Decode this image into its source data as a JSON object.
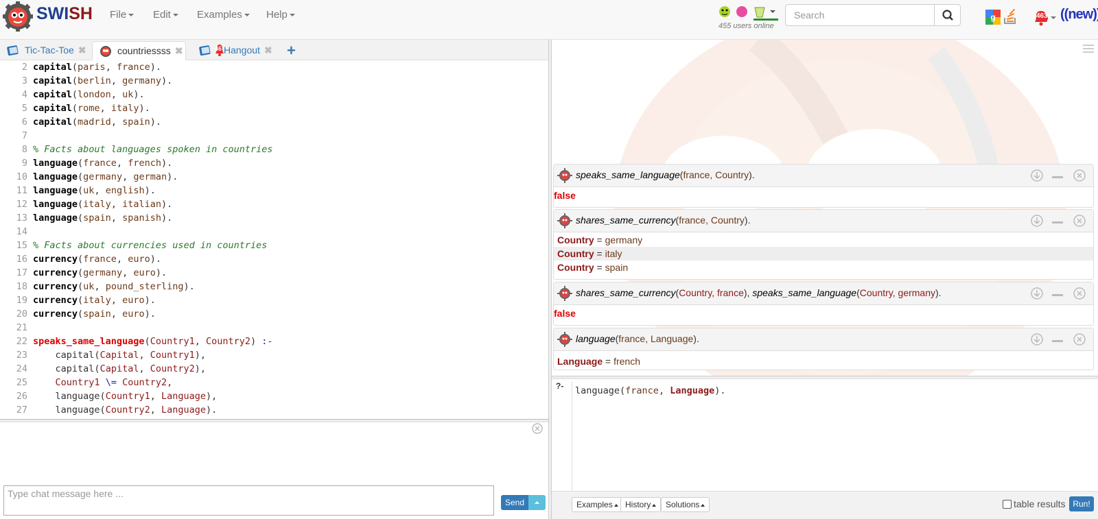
{
  "brand": {
    "part1": "SWI",
    "part2": "SH"
  },
  "menu": [
    {
      "label": "File"
    },
    {
      "label": "Edit"
    },
    {
      "label": "Examples"
    },
    {
      "label": "Help"
    }
  ],
  "users_online": "455 users online",
  "search": {
    "placeholder": "Search",
    "value": ""
  },
  "notification_count": "463",
  "new_badge": "((new))",
  "tabs": [
    {
      "label": "Tic-Tac-Toe"
    },
    {
      "label": "countriessss",
      "active": true
    },
    {
      "label": "Hangout",
      "badge": "46"
    }
  ],
  "editor": {
    "line_numbers": [
      "2",
      "3",
      "4",
      "5",
      "6",
      "7",
      "8",
      "9",
      "10",
      "11",
      "12",
      "13",
      "14",
      "15",
      "16",
      "17",
      "18",
      "19",
      "20",
      "21",
      "22",
      "23",
      "24",
      "25",
      "26",
      "27"
    ],
    "lines": [
      "capital(paris, france).",
      "capital(berlin, germany).",
      "capital(london, uk).",
      "capital(rome, italy).",
      "capital(madrid, spain).",
      "",
      "% Facts about languages spoken in countries",
      "language(france, french).",
      "language(germany, german).",
      "language(uk, english).",
      "language(italy, italian).",
      "language(spain, spanish).",
      "",
      "% Facts about currencies used in countries",
      "currency(france, euro).",
      "currency(germany, euro).",
      "currency(uk, pound_sterling).",
      "currency(italy, euro).",
      "currency(spain, euro).",
      "",
      "speaks_same_language(Country1, Country2) :-",
      "    capital(Capital, Country1),",
      "    capital(Capital, Country2),",
      "    Country1 \\= Country2,",
      "    language(Country1, Language),",
      "    language(Country2, Language)."
    ]
  },
  "chat": {
    "placeholder": "Type chat message here ...",
    "send_label": "Send"
  },
  "queries": [
    {
      "pred": "speaks_same_language",
      "args": "france, Country",
      "result": "false"
    },
    {
      "pred": "shares_same_currency",
      "args": "france, Country",
      "answers": [
        {
          "var": "Country",
          "eq": " = ",
          "val": "germany"
        },
        {
          "var": "Country",
          "eq": " = ",
          "val": "italy"
        },
        {
          "var": "Country",
          "eq": " = ",
          "val": "spain"
        }
      ]
    },
    {
      "pred": "shares_same_currency",
      "args": "Country, france",
      "pred2": "speaks_same_language",
      "args2": "Country, germany",
      "result": "false"
    },
    {
      "pred": "language",
      "args": "france, Language",
      "answers": [
        {
          "var": "Language",
          "eq": " = ",
          "val": "french"
        }
      ]
    }
  ],
  "query_editor": {
    "prompt": "?-",
    "pred": "language",
    "atom": "france",
    "var": "Language"
  },
  "bottom_bar": {
    "examples": "Examples",
    "history": "History",
    "solutions": "Solutions",
    "table_results": "table results",
    "run": "Run!"
  }
}
